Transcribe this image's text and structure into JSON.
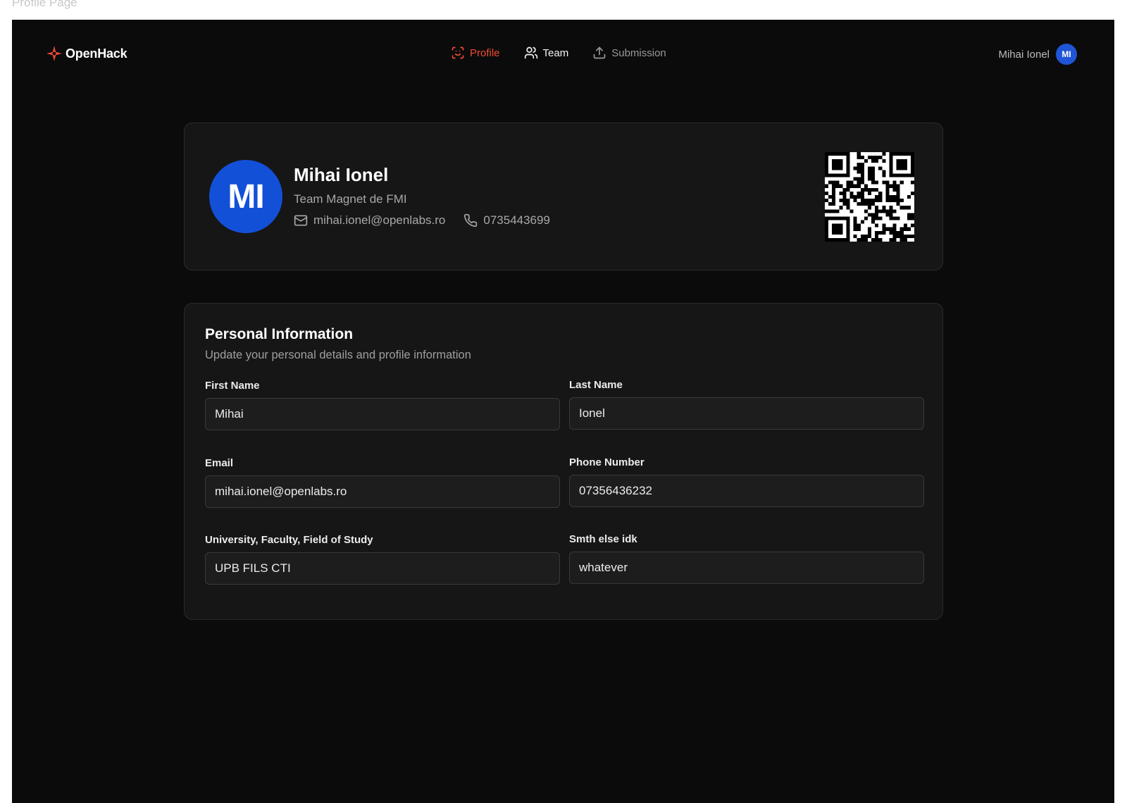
{
  "frame": {
    "label": "Profile Page"
  },
  "brand": {
    "name": "OpenHack",
    "icon": "sparkle-icon",
    "accent": "#ef4b34"
  },
  "nav": {
    "items": [
      {
        "label": "Profile",
        "icon": "scan-face-icon",
        "active": true
      },
      {
        "label": "Team",
        "icon": "users-icon",
        "active": false
      },
      {
        "label": "Submission",
        "icon": "upload-icon",
        "active": false
      }
    ]
  },
  "user_menu": {
    "name": "Mihai Ionel",
    "initials": "MI",
    "avatar_color": "#1f55d6"
  },
  "profile": {
    "initials": "MI",
    "name": "Mihai Ionel",
    "team": "Team Magnet de FMI",
    "email": "mihai.ionel@openlabs.ro",
    "phone": "0735443699",
    "qr_icon": "qr-code-icon"
  },
  "personal_info": {
    "title": "Personal Information",
    "subtitle": "Update your personal details and profile information",
    "fields": {
      "first_name": {
        "label": "First Name",
        "value": "Mihai"
      },
      "last_name": {
        "label": "Last Name",
        "value": "Ionel"
      },
      "email": {
        "label": "Email",
        "value": "mihai.ionel@openlabs.ro"
      },
      "phone": {
        "label": "Phone Number",
        "value": "07356436232"
      },
      "university": {
        "label": "University, Faculty, Field of Study",
        "value": "UPB FILS CTI"
      },
      "other": {
        "label": "Smth else idk",
        "value": "whatever"
      }
    }
  }
}
